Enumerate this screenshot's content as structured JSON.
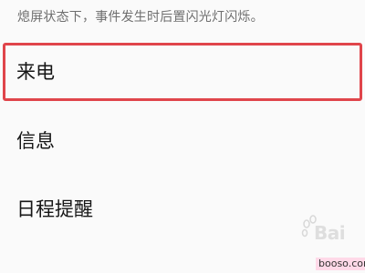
{
  "settings": {
    "description": "熄屏状态下，事件发生时后置闪光灯闪烁。",
    "items": [
      {
        "label": "来电",
        "selected": true
      },
      {
        "label": "信息",
        "selected": false
      },
      {
        "label": "日程提醒",
        "selected": false
      }
    ]
  },
  "overlay": {
    "watermark_text": "Bai",
    "site_label": "booso.com"
  },
  "colors": {
    "highlight": "#e0454b",
    "description_text": "#6e6e6e",
    "item_text": "#161616"
  }
}
